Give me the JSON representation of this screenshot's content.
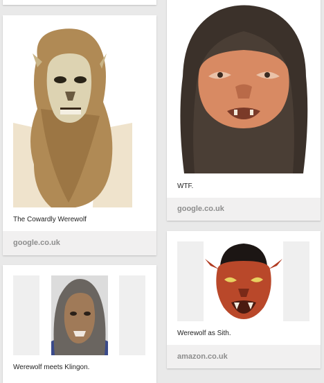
{
  "pins": [
    {
      "caption": "",
      "source": ""
    },
    {
      "caption": "The Cowardly Werewolf",
      "source": "google.co.uk",
      "image_name": "werewolf-blonde-mask"
    },
    {
      "caption": "WTF.",
      "source": "google.co.uk",
      "image_name": "werewolf-hairy-mask"
    },
    {
      "caption": "Werewolf meets Klingon.",
      "source": "",
      "image_name": "werewolf-klingon-mask"
    },
    {
      "caption": "Werewolf as Sith.",
      "source": "amazon.co.uk",
      "image_name": "werewolf-sith-mask"
    }
  ]
}
